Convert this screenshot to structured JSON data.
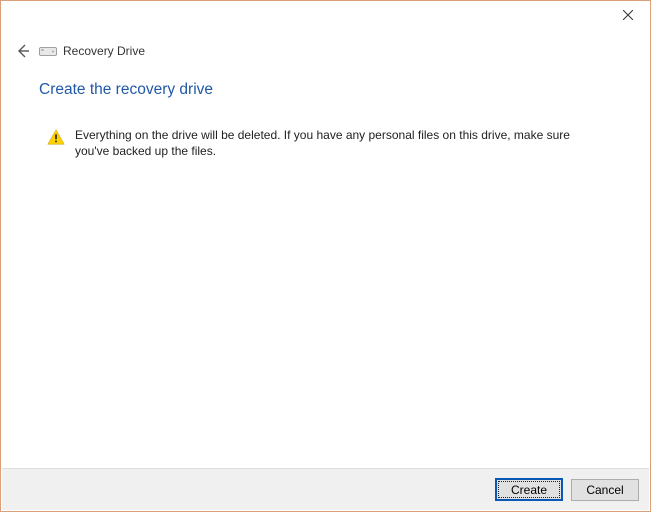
{
  "window": {
    "title": "Recovery Drive"
  },
  "page": {
    "heading": "Create the recovery drive",
    "warning": "Everything on the drive will be deleted. If you have any personal files on this drive, make sure you've backed up the files."
  },
  "footer": {
    "primary": "Create",
    "cancel": "Cancel"
  },
  "colors": {
    "heading": "#2158a8",
    "warning_icon_fill": "#ffd200",
    "warning_icon_stroke": "#8a6d00"
  }
}
